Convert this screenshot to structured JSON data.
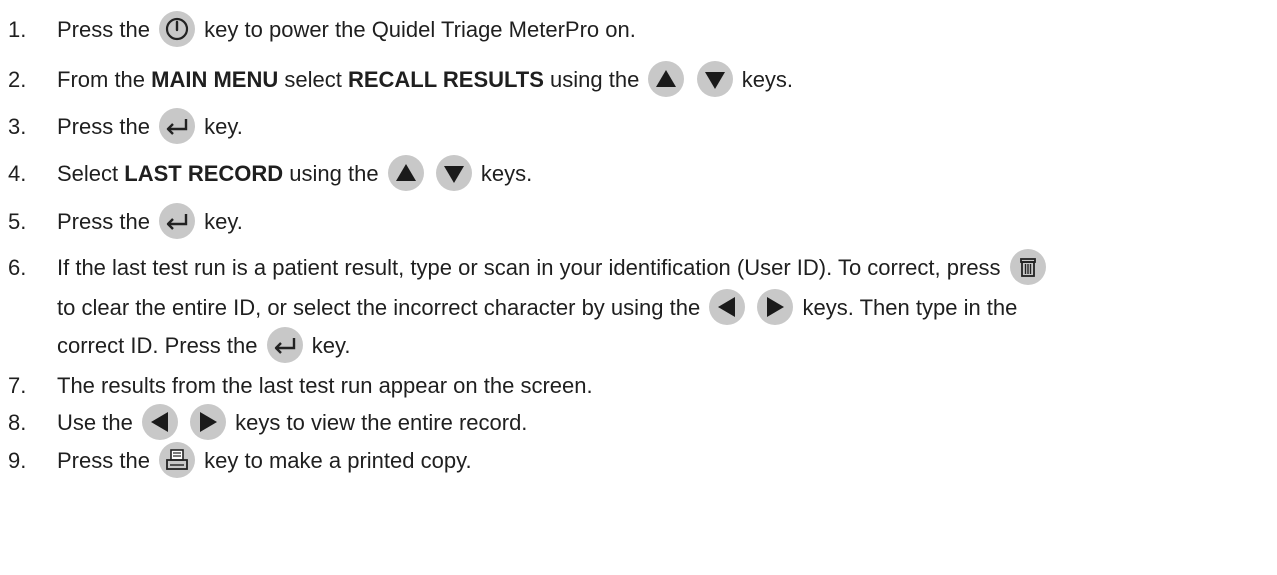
{
  "steps": [
    {
      "num": "1.",
      "parts": [
        "Press the ",
        {
          "key": "power-icon"
        },
        " key to power the Quidel Triage MeterPro on."
      ]
    },
    {
      "num": "2.",
      "parts": [
        "From the ",
        {
          "b": "MAIN MENU"
        },
        " select ",
        {
          "b": "RECALL RESULTS"
        },
        " using the ",
        {
          "key": "up-arrow-icon"
        },
        " ",
        {
          "key": "down-arrow-icon"
        },
        " keys."
      ]
    },
    {
      "num": "3.",
      "parts": [
        "Press the ",
        {
          "key": "enter-icon"
        },
        " key."
      ]
    },
    {
      "num": "4.",
      "parts": [
        "Select ",
        {
          "b": "LAST RECORD"
        },
        " using the ",
        {
          "key": "up-arrow-icon"
        },
        " ",
        {
          "key": "down-arrow-icon"
        },
        " keys."
      ]
    },
    {
      "num": "5.",
      "parts": [
        "Press the ",
        {
          "key": "enter-icon"
        },
        " key."
      ]
    },
    {
      "num": "6.",
      "lines": [
        [
          "If the last test run is a patient result, type or scan in your identification (User ID). To correct, press ",
          {
            "key": "trash-icon"
          }
        ],
        [
          "to clear the entire ID, or select the incorrect character by using the ",
          {
            "key": "left-arrow-icon"
          },
          " ",
          {
            "key": "right-arrow-icon"
          },
          " keys.  Then type in the"
        ],
        [
          "correct ID. Press the ",
          {
            "key": "enter-icon"
          },
          " key."
        ]
      ]
    },
    {
      "num": "7.",
      "parts": [
        "The results from the last test run appear on the screen."
      ]
    },
    {
      "num": "8.",
      "parts": [
        "Use the ",
        {
          "key": "left-arrow-icon"
        },
        " ",
        {
          "key": "right-arrow-icon"
        },
        " keys to view the entire record."
      ]
    },
    {
      "num": "9.",
      "parts": [
        "Press the ",
        {
          "key": "printer-icon"
        },
        " key to make a printed copy."
      ]
    }
  ]
}
